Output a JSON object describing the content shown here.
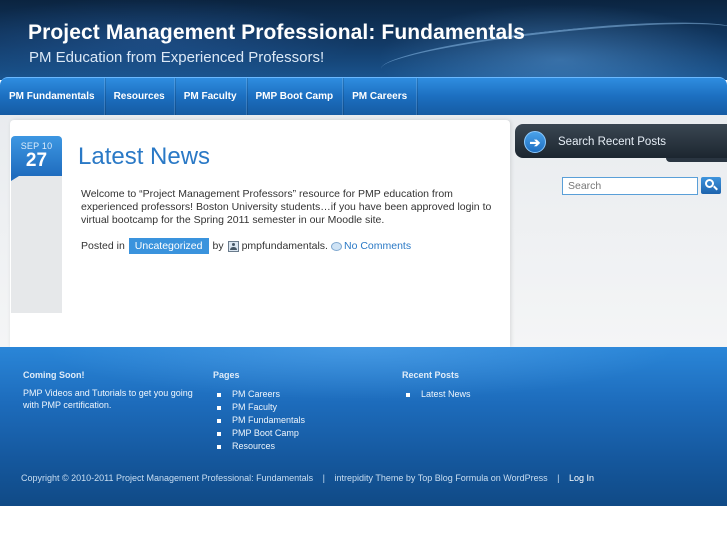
{
  "header": {
    "title": "Project Management Professional: Fundamentals",
    "tagline": "PM Education from Experienced Professors!"
  },
  "nav": {
    "items": [
      {
        "label": "PM Fundamentals"
      },
      {
        "label": "Resources"
      },
      {
        "label": "PM Faculty"
      },
      {
        "label": "PMP Boot Camp"
      },
      {
        "label": "PM Careers"
      }
    ]
  },
  "post": {
    "date_month_day": "SEP 10",
    "date_day": "27",
    "title": "Latest News",
    "body": "Welcome to “Project Management Professors” resource for PMP education from experienced professors! Boston University students…if you have been approved login to virtual bootcamp for the Spring 2011 semester in our Moodle site.",
    "posted_in_label": "Posted in",
    "category": "Uncategorized",
    "by_label": "by",
    "author": "pmpfundamentals.",
    "comments": "No Comments"
  },
  "sidebar": {
    "widget_title": "Search Recent Posts",
    "search_placeholder": "Search"
  },
  "footer": {
    "col1": {
      "heading": "Coming Soon!",
      "text": "PMP Videos and Tutorials to get you going with PMP certification."
    },
    "col2": {
      "heading": "Pages",
      "items": [
        "PM Careers",
        "PM Faculty",
        "PM Fundamentals",
        "PMP Boot Camp",
        "Resources"
      ]
    },
    "col3": {
      "heading": "Recent Posts",
      "items": [
        "Latest News"
      ]
    },
    "copyright": "Copyright © 2010-2011 Project Management Professional: Fundamentals",
    "separator": "|",
    "theme_credit": "intrepidity Theme by Top Blog Formula on WordPress",
    "login": "Log In"
  },
  "colors": {
    "accent": "#2a79c6",
    "nav": "#1c6fc0",
    "header": "#123a66",
    "footer": "#1d6cbc"
  }
}
